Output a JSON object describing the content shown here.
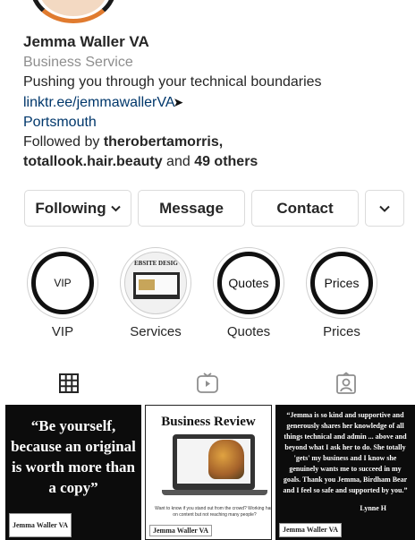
{
  "profile": {
    "name": "Jemma Waller VA",
    "category": "Business Service",
    "bio": "Pushing you through your technical boundaries",
    "link": "linktr.ee/jemmawallerVA",
    "location": "Portsmouth",
    "followed_prefix": "Followed by ",
    "followed_user1": "therobertamorris,",
    "followed_user2": "totallook.hair.beauty",
    "followed_and": " and ",
    "followed_others": "49 others"
  },
  "actions": {
    "following_label": "Following",
    "message_label": "Message",
    "contact_label": "Contact"
  },
  "highlights": [
    {
      "label": "VIP",
      "cover_text": "VIP"
    },
    {
      "label": "Services",
      "cover_text": "EBSITE DESIG"
    },
    {
      "label": "Quotes",
      "cover_text": "Quotes"
    },
    {
      "label": "Prices",
      "cover_text": "Prices"
    }
  ],
  "tabs": [
    {
      "icon": "grid-icon",
      "active": true
    },
    {
      "icon": "reels-icon",
      "active": false
    },
    {
      "icon": "tagged-icon",
      "active": false
    }
  ],
  "posts": [
    {
      "text": "“Be yourself, because an original is worth more than a copy”",
      "signature": "Jemma Waller VA"
    },
    {
      "title": "Business Review",
      "caption": "Want to know if you stand out from the crowd? Working hard on content but not reaching many people?",
      "signature": "Jemma Waller VA"
    },
    {
      "text": "“Jemma is so kind and supportive and generously shares her knowledge of all things technical and admin ... above and beyond what I ask her to do. She totally 'gets' my business and I know she genuinely wants me to succeed in my goals. Thank you Jemma, Birdham Bear and I feel so safe and supported by you.”",
      "author": "Lynne H",
      "signature": "Jemma Waller VA"
    }
  ],
  "colors": {
    "link": "#00376b",
    "muted": "#8e8e8e",
    "border": "#dbdbdb"
  }
}
